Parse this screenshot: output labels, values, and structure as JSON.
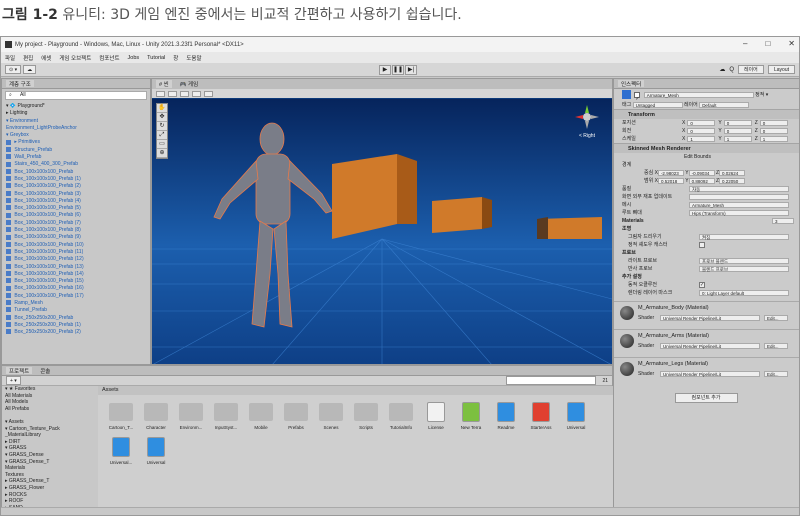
{
  "caption": {
    "label": "그림 1-2",
    "text": "유니티: 3D 게임 엔진 중에서는 비교적 간편하고 사용하기 쉽습니다."
  },
  "window": {
    "title": "My project - Playground - Windows, Mac, Linux - Unity 2021.3.23f1 Personal* <DX11>",
    "controls": [
      "–",
      "□",
      "✕"
    ]
  },
  "menu": [
    "파일",
    "편집",
    "에셋",
    "게임 오브젝트",
    "컴포넌트",
    "Jobs",
    "Tutorial",
    "창",
    "도움말"
  ],
  "toolbar": {
    "left_btn": "⊙ ▾",
    "right": [
      "☁",
      "Q",
      "레이어",
      "Layout"
    ]
  },
  "hierarchy": {
    "tab": "계층 구조",
    "search": "All",
    "items": [
      {
        "t": "▾ 💠 Playground*",
        "b": false
      },
      {
        "t": "  ▸ Lighting",
        "b": false
      },
      {
        "t": "  ▾ Environment",
        "b": true
      },
      {
        "t": "      Environment_LightProbeAnchor",
        "b": true
      },
      {
        "t": "  ▾ Greybox",
        "b": true
      },
      {
        "t": "    ▸ Primitives",
        "b": true
      },
      {
        "t": "      Structure_Prefab",
        "b": true
      },
      {
        "t": "      Wall_Prefab",
        "b": true
      },
      {
        "t": "      Stairs_450_400_300_Prefab",
        "b": true
      },
      {
        "t": "      Box_100x100x100_Prefab",
        "b": true
      },
      {
        "t": "      Box_100x100x100_Prefab (1)",
        "b": true
      },
      {
        "t": "      Box_100x100x100_Prefab (2)",
        "b": true
      },
      {
        "t": "      Box_100x100x100_Prefab (3)",
        "b": true
      },
      {
        "t": "      Box_100x100x100_Prefab (4)",
        "b": true
      },
      {
        "t": "      Box_100x100x100_Prefab (5)",
        "b": true
      },
      {
        "t": "      Box_100x100x100_Prefab (6)",
        "b": true
      },
      {
        "t": "      Box_100x100x100_Prefab (7)",
        "b": true
      },
      {
        "t": "      Box_100x100x100_Prefab (8)",
        "b": true
      },
      {
        "t": "      Box_100x100x100_Prefab (9)",
        "b": true
      },
      {
        "t": "      Box_100x100x100_Prefab (10)",
        "b": true
      },
      {
        "t": "      Box_100x100x100_Prefab (11)",
        "b": true
      },
      {
        "t": "      Box_100x100x100_Prefab (12)",
        "b": true
      },
      {
        "t": "      Box_100x100x100_Prefab (13)",
        "b": true
      },
      {
        "t": "      Box_100x100x100_Prefab (14)",
        "b": true
      },
      {
        "t": "      Box_100x100x100_Prefab (15)",
        "b": true
      },
      {
        "t": "      Box_100x100x100_Prefab (16)",
        "b": true
      },
      {
        "t": "      Box_100x100x100_Prefab (17)",
        "b": true
      },
      {
        "t": "      Ramp_Mesh",
        "b": true
      },
      {
        "t": "      Tunnel_Prefab",
        "b": true
      },
      {
        "t": "      Box_250x250x200_Prefab",
        "b": true
      },
      {
        "t": "      Box_250x250x200_Prefab (1)",
        "b": true
      },
      {
        "t": "      Box_250x250x200_Prefab (2)",
        "b": true
      }
    ]
  },
  "scene": {
    "tabs": [
      "# 씬",
      "🎮 게임"
    ],
    "persp": "< Right"
  },
  "project": {
    "tabs": [
      "프로젝트",
      "콘솔"
    ],
    "tree": [
      "▾ ★ Favorites",
      "   All Materials",
      "   All Models",
      "   All Prefabs",
      "",
      "▾ Assets",
      "  ▾ Cartoon_Texture_Pack",
      "      _MaterialLibrary",
      "  ▸ DIRT",
      "  ▾ GRASS",
      "    ▾ GRASS_Dense",
      "      ▾ GRASS_Dense_T",
      "          Materials",
      "          Textures",
      "      ▸ GRASS_Dense_T",
      "    ▸ GRASS_Flower",
      "  ▸ ROCKS",
      "  ▸ ROOF",
      "  ▸ SAND",
      "  ▸ WALLS",
      "  ▸ WOOD"
    ],
    "assets_title": "Assets",
    "assets": [
      {
        "n": "Cartoon_T...",
        "k": "folder"
      },
      {
        "n": "Character",
        "k": "folder"
      },
      {
        "n": "Environm...",
        "k": "folder"
      },
      {
        "n": "InputSyst...",
        "k": "folder"
      },
      {
        "n": "Mobile",
        "k": "folder"
      },
      {
        "n": "Prefabs",
        "k": "folder"
      },
      {
        "n": "Scenes",
        "k": "folder"
      },
      {
        "n": "Scripts",
        "k": "folder"
      },
      {
        "n": "TutorialInfo",
        "k": "folder"
      },
      {
        "n": "License",
        "k": "doc"
      },
      {
        "n": "New Terra",
        "k": "terrain"
      },
      {
        "n": "Readme",
        "k": "cube"
      },
      {
        "n": "StarterAss",
        "k": "pdf"
      },
      {
        "n": "Universal",
        "k": "cube"
      },
      {
        "n": "Universal...",
        "k": "cube"
      },
      {
        "n": "Universal",
        "k": "cube"
      }
    ],
    "count": "21"
  },
  "inspector": {
    "tab": "인스펙터",
    "object_name": "Armature_Mesh",
    "static": "정적 ▾",
    "tag_label": "태그",
    "tag": "Untagged",
    "layer_label": "레이어",
    "layer": "Default",
    "transform": {
      "title": "Transform",
      "rows": [
        {
          "l": "포지션",
          "x": "0",
          "y": "0",
          "z": "0"
        },
        {
          "l": "회전",
          "x": "0",
          "y": "0",
          "z": "0"
        },
        {
          "l": "스케일",
          "x": "1",
          "y": "1",
          "z": "1"
        }
      ]
    },
    "smr": {
      "title": "Skinned Mesh Renderer",
      "edit": "Edit Bounds",
      "bounds": "경계",
      "center_label": "중심",
      "center": [
        "-2.98023",
        "-0.09034",
        "0.02624"
      ],
      "extent_label": "범위",
      "extent": [
        "0.52018",
        "0.88092",
        "0.22050"
      ],
      "rows": [
        [
          "품질",
          "자동"
        ],
        [
          "화면 외부 재포 업데이트",
          ""
        ],
        [
          "메시",
          "Armature_Mesh"
        ],
        [
          "루트 뼈대",
          "Hips (Transform)"
        ]
      ],
      "materials_label": "Materials",
      "materials_count": "3",
      "light_label": "조명",
      "cast_label": "그림자 드리우기",
      "cast": "켜짐",
      "receive_label": "정적 셰도우 캐스터",
      "probe_label": "프로브",
      "lp_label": "라이트 프로브",
      "lp": "프로브 블렌드",
      "rp_label": "반사 프로브",
      "rp": "블렌드 프로브",
      "extra_label": "추가 설정",
      "motion_label": "동적 오클루전",
      "rlayer_label": "렌더링 레이어 마스크",
      "rlayer": "0: Light Layer default"
    },
    "materials": [
      {
        "name": "M_Armature_Body (Material)",
        "shader": "Universal Render Pipeline/Lit"
      },
      {
        "name": "M_Armature_Arms (Material)",
        "shader": "Universal Render Pipeline/Lit"
      },
      {
        "name": "M_Armature_Legs (Material)",
        "shader": "Universal Render Pipeline/Lit"
      }
    ],
    "shader_label": "Shader",
    "edit_btn": "Edit...",
    "add_component": "컴포넌트 추가"
  }
}
